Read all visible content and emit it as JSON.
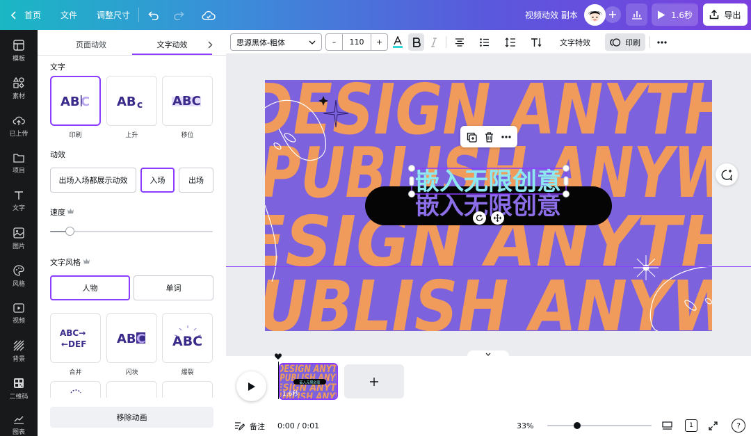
{
  "topbar": {
    "home": "首页",
    "file": "文件",
    "resize": "调整尺寸",
    "doc_title": "视频动效 副本",
    "play_duration": "1.6秒",
    "export": "导出"
  },
  "rail": {
    "items": [
      "模板",
      "素材",
      "已上传",
      "项目",
      "文字",
      "图片",
      "风格",
      "视频",
      "背景",
      "二维码",
      "图表"
    ]
  },
  "panel": {
    "tab_page": "页面动效",
    "tab_text": "文字动效",
    "section_text": "文字",
    "text_anims": [
      {
        "glyph": "ABC",
        "label": "印刷"
      },
      {
        "glyph": "ABc",
        "label": "上升"
      },
      {
        "glyph": "ABC",
        "label": "移位"
      }
    ],
    "section_effect": "动效",
    "effect_both": "出场入场都展示动效",
    "effect_in": "入场",
    "effect_out": "出场",
    "section_speed": "速度",
    "speed_value": 0.12,
    "section_style": "文字风格",
    "style_character": "人物",
    "style_word": "单词",
    "more_anims": [
      {
        "glyph_top": "ABC→",
        "glyph_bottom": "←DEF",
        "label": "合并"
      },
      {
        "glyph": "ABC",
        "label": "闪块"
      },
      {
        "glyph": "ABC",
        "label": "爆裂"
      }
    ],
    "remove": "移除动画"
  },
  "toolbar": {
    "font": "思源黑体-粗体",
    "minus": "–",
    "size": "110",
    "plus": "+",
    "text_effects": "文字特效",
    "print": "印刷"
  },
  "canvas": {
    "rows": [
      "DESIGN ANYTH",
      "PUBLISH ANYW",
      "ESIGN ANYTH",
      "UBLISH ANYW"
    ],
    "text_1": "嵌入无限创意",
    "text_2": "嵌入无限创意"
  },
  "timeline": {
    "thumb_duration": "1.6秒",
    "thumb_text": "嵌入无限创意"
  },
  "bottombar": {
    "notes": "备注",
    "time": "0:00 / 0:01",
    "zoom": "33%",
    "zoom_value": 0.33,
    "page": "1"
  },
  "colors": {
    "accent": "#8b3dff",
    "poster_bg": "#7c62dc",
    "poster_text": "#f09a5c",
    "text_fill": "#8ee8f0"
  }
}
